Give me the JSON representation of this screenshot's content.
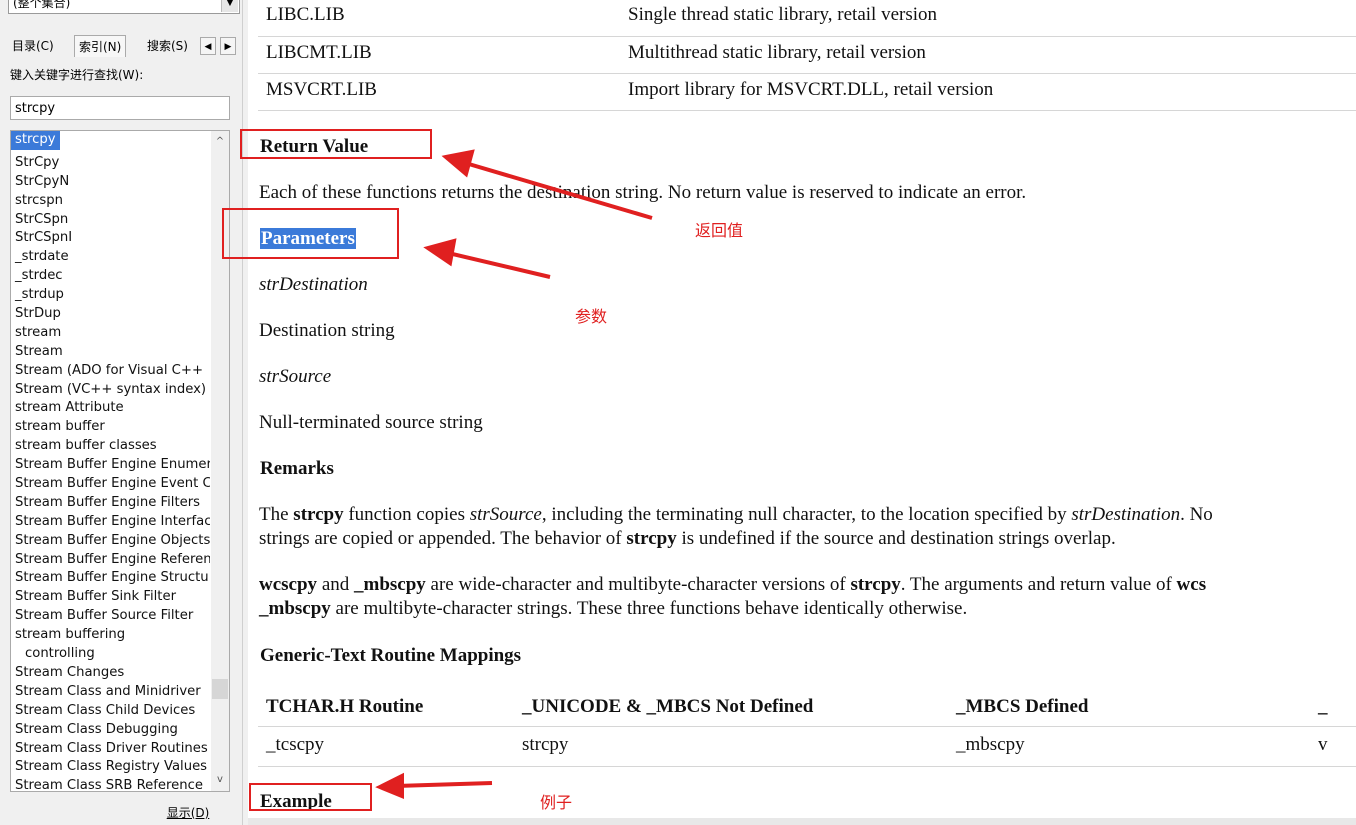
{
  "left_pane": {
    "scope_value": "(整个集合)",
    "tabs": {
      "contents": "目录(C)",
      "index": "索引(N)",
      "search": "搜索(S)",
      "prev": "◀",
      "next": "▶"
    },
    "keyword_label": "键入关键字进行查找(W):",
    "search_value": "strcpy",
    "list_items": [
      "strcpy",
      "StrCpy",
      "StrCpyN",
      "strcspn",
      "StrCSpn",
      "StrCSpnI",
      "_strdate",
      "_strdec",
      "_strdup",
      "StrDup",
      "stream",
      "Stream",
      "Stream (ADO for Visual C++",
      "Stream (VC++ syntax index)",
      "stream Attribute",
      "stream buffer",
      "stream buffer classes",
      "Stream Buffer Engine Enumer",
      "Stream Buffer Engine Event C",
      "Stream Buffer Engine Filters",
      "Stream Buffer Engine Interfac",
      "Stream Buffer Engine Objects",
      "Stream Buffer Engine Referen",
      "Stream Buffer Engine Structu",
      "Stream Buffer Sink Filter",
      "Stream Buffer Source Filter",
      "stream buffering",
      "controlling",
      "Stream Changes",
      "Stream Class and Minidriver",
      "Stream Class Child Devices",
      "Stream Class Debugging",
      "Stream Class Driver Routines",
      "Stream Class Registry Values",
      "Stream Class SRB Reference"
    ],
    "show_button": "显示(D)"
  },
  "content": {
    "lib_rows": [
      {
        "name": "LIBC.LIB",
        "desc": "Single thread static library, retail version"
      },
      {
        "name": "LIBCMT.LIB",
        "desc": "Multithread static library, retail version"
      },
      {
        "name": "MSVCRT.LIB",
        "desc": "Import library for MSVCRT.DLL, retail version"
      }
    ],
    "return_value_heading": "Return Value",
    "return_value_text": "Each of these functions returns the destination string. No return value is reserved to indicate an error.",
    "parameters_heading": "Parameters",
    "param1_name": "strDestination",
    "param1_desc": "Destination string",
    "param2_name": "strSource",
    "param2_desc": "Null-terminated source string",
    "remarks_heading": "Remarks",
    "remarks_p1": {
      "a": "The ",
      "b": "strcpy",
      "c": " function copies ",
      "d": "strSource",
      "e": ", including the terminating null character, to the location specified by ",
      "f": "strDestination",
      "g": ". No",
      "line2_a": "strings are copied or appended. The behavior of ",
      "line2_b": "strcpy",
      "line2_c": " is undefined if the source and destination strings overlap."
    },
    "remarks_p2": {
      "a": "wcscpy",
      "b": " and ",
      "c": "_mbscpy",
      "d": " are wide-character and multibyte-character versions of ",
      "e": "strcpy",
      "f": ". The arguments and return value of ",
      "g": "wcs",
      "line2_a": "_mbscpy",
      "line2_b": " are multibyte-character strings. These three functions behave identically otherwise."
    },
    "mappings_heading": "Generic-Text Routine Mappings",
    "mapping_headers": [
      "TCHAR.H Routine",
      "_UNICODE & _MBCS Not Defined",
      "_MBCS Defined",
      "_"
    ],
    "mapping_row": [
      "_tcscpy",
      "strcpy",
      "_mbscpy",
      "v"
    ],
    "example_heading": "Example"
  },
  "annotations": {
    "return_value_note": "返回值",
    "parameters_note": "参数",
    "example_note": "例子",
    "color": "#e02020"
  },
  "colors": {
    "selection": "#3b7ad9",
    "accent_red": "#e02020"
  }
}
